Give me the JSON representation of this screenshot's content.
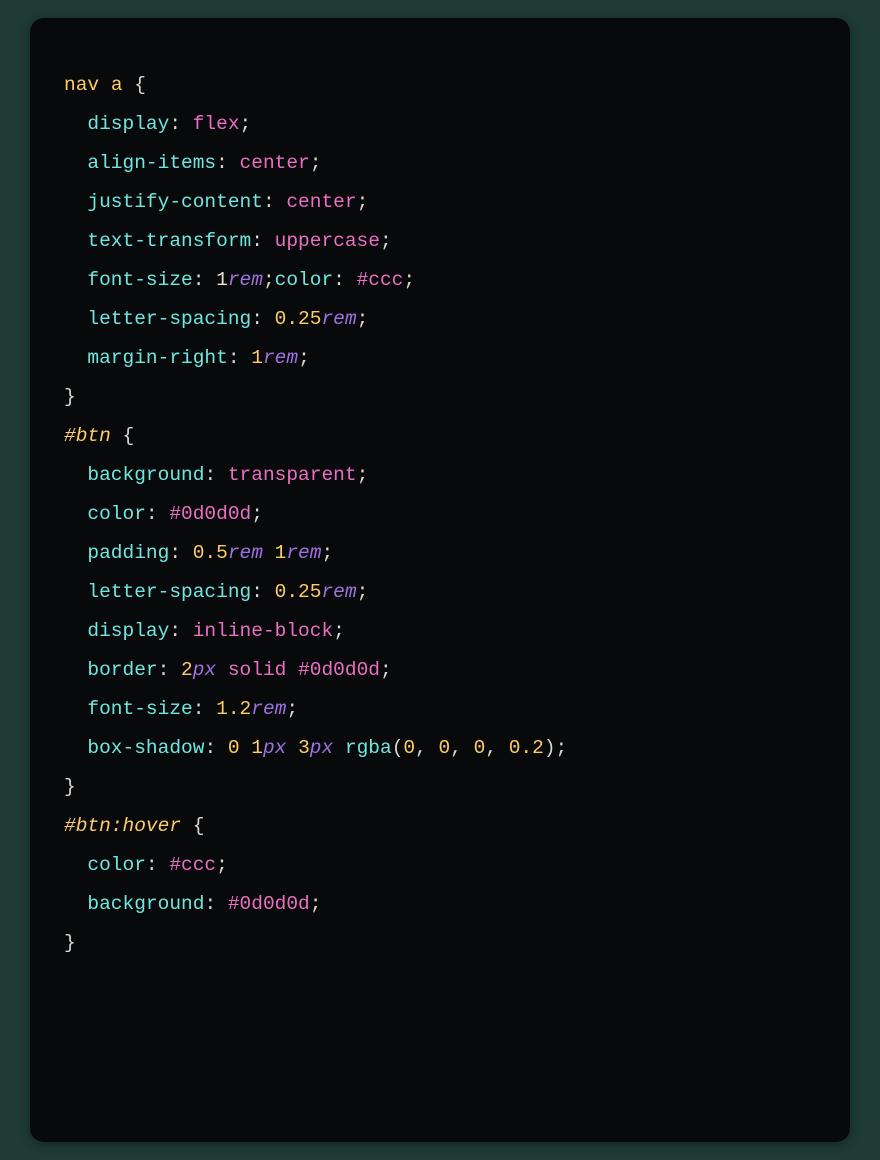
{
  "code": {
    "line1": {
      "sel1": "nav",
      "sel2": "a",
      "brace": "{"
    },
    "line2": {
      "prop": "display",
      "colon": ":",
      "val": "flex",
      "semi": ";"
    },
    "line3": {
      "prop": "align-items",
      "colon": ":",
      "val": "center",
      "semi": ";"
    },
    "line4": {
      "prop": "justify-content",
      "colon": ":",
      "val": "center",
      "semi": ";"
    },
    "line5": {
      "prop": "text-transform",
      "colon": ":",
      "val": "uppercase",
      "semi": ";"
    },
    "line6": {
      "prop1": "font-size",
      "colon1": ":",
      "num1": "1",
      "unit1": "rem",
      "semi1": ";",
      "prop2": "color",
      "colon2": ":",
      "val2": "#ccc",
      "semi2": ";"
    },
    "line7": {
      "prop": "letter-spacing",
      "colon": ":",
      "num": "0.25",
      "unit": "rem",
      "semi": ";"
    },
    "line8": {
      "prop": "margin-right",
      "colon": ":",
      "num": "1",
      "unit": "rem",
      "semi": ";"
    },
    "line9": {
      "brace": "}"
    },
    "line10": {
      "sel": "#btn",
      "brace": "{"
    },
    "line11": {
      "prop": "background",
      "colon": ":",
      "val": "transparent",
      "semi": ";"
    },
    "line12": {
      "prop": "color",
      "colon": ":",
      "val": "#0d0d0d",
      "semi": ";"
    },
    "line13": {
      "prop": "padding",
      "colon": ":",
      "num1": "0.5",
      "unit1": "rem",
      "num2": "1",
      "unit2": "rem",
      "semi": ";"
    },
    "line14": {
      "prop": "letter-spacing",
      "colon": ":",
      "num": "0.25",
      "unit": "rem",
      "semi": ";"
    },
    "line15": {
      "prop": "display",
      "colon": ":",
      "val": "inline-block",
      "semi": ";"
    },
    "line16": {
      "prop": "border",
      "colon": ":",
      "num": "2",
      "unit": "px",
      "val1": "solid",
      "val2": "#0d0d0d",
      "semi": ";"
    },
    "line17": {
      "prop": "font-size",
      "colon": ":",
      "num": "1.2",
      "unit": "rem",
      "semi": ";"
    },
    "line18": {
      "prop": "box-shadow",
      "colon": ":",
      "num1": "0",
      "num2": "1",
      "unit2": "px",
      "num3": "3",
      "unit3": "px",
      "func": "rgba",
      "open": "(",
      "a1": "0",
      "c1": ",",
      "a2": "0",
      "c2": ",",
      "a3": "0",
      "c3": ",",
      "a4": "0.2",
      "close": ")",
      "semi": ";"
    },
    "line19": {
      "brace": "}"
    },
    "line20": {
      "sel": "#btn",
      "pseudo": ":hover",
      "brace": "{"
    },
    "line21": {
      "prop": "color",
      "colon": ":",
      "val": "#ccc",
      "semi": ";"
    },
    "line22": {
      "prop": "background",
      "colon": ":",
      "val": "#0d0d0d",
      "semi": ";"
    },
    "line23": {
      "brace": "}"
    }
  }
}
